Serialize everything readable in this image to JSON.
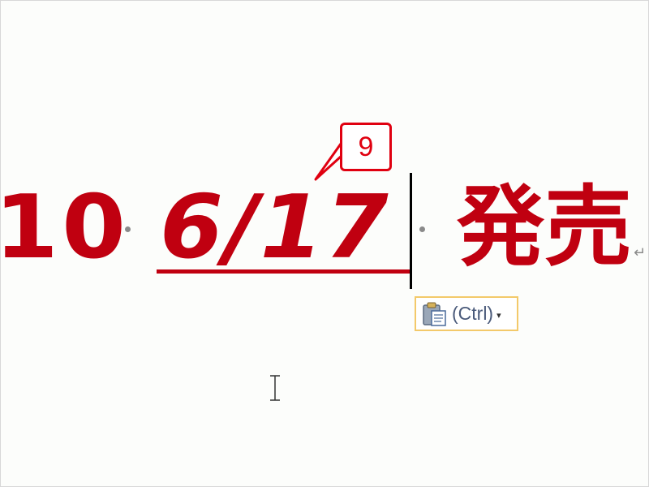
{
  "document": {
    "left_number": "10",
    "date": "6/17",
    "kanji": "発売",
    "paragraph_mark": "↵"
  },
  "callout": {
    "number": "9"
  },
  "paste_options": {
    "label": "(Ctrl)",
    "dropdown_glyph": "▾",
    "icon": "clipboard-icon"
  },
  "cursor": {
    "icon": "ibeam-cursor-icon"
  },
  "colors": {
    "text_red": "#c00010",
    "callout_red": "#e00010",
    "paste_border": "#f3c96a"
  }
}
